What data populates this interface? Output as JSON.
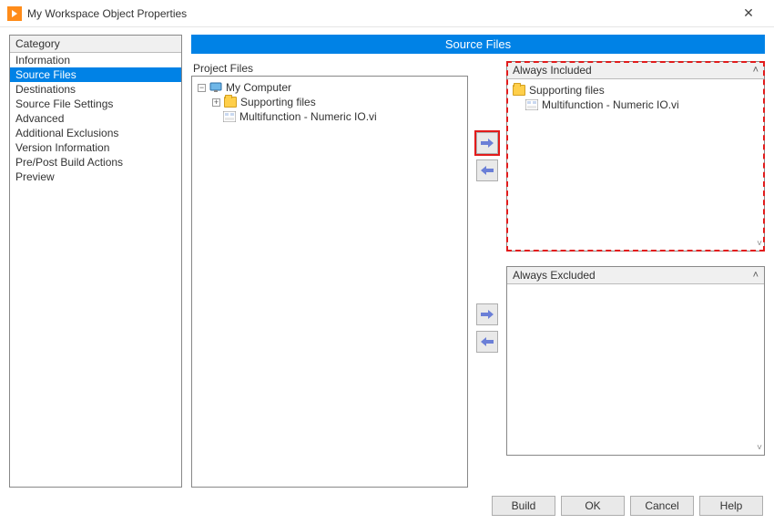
{
  "window": {
    "title": "My Workspace Object Properties"
  },
  "category": {
    "header": "Category",
    "items": [
      "Information",
      "Source Files",
      "Destinations",
      "Source File Settings",
      "Advanced",
      "Additional Exclusions",
      "Version Information",
      "Pre/Post Build Actions",
      "Preview"
    ],
    "selected_index": 1
  },
  "page": {
    "title": "Source Files"
  },
  "project": {
    "label": "Project Files",
    "root": "My Computer",
    "folder": "Supporting files",
    "vi": "Multifunction - Numeric IO.vi"
  },
  "included": {
    "header": "Always Included",
    "folder": "Supporting files",
    "vi": "Multifunction - Numeric IO.vi"
  },
  "excluded": {
    "header": "Always Excluded"
  },
  "buttons": {
    "build": "Build",
    "ok": "OK",
    "cancel": "Cancel",
    "help": "Help"
  }
}
